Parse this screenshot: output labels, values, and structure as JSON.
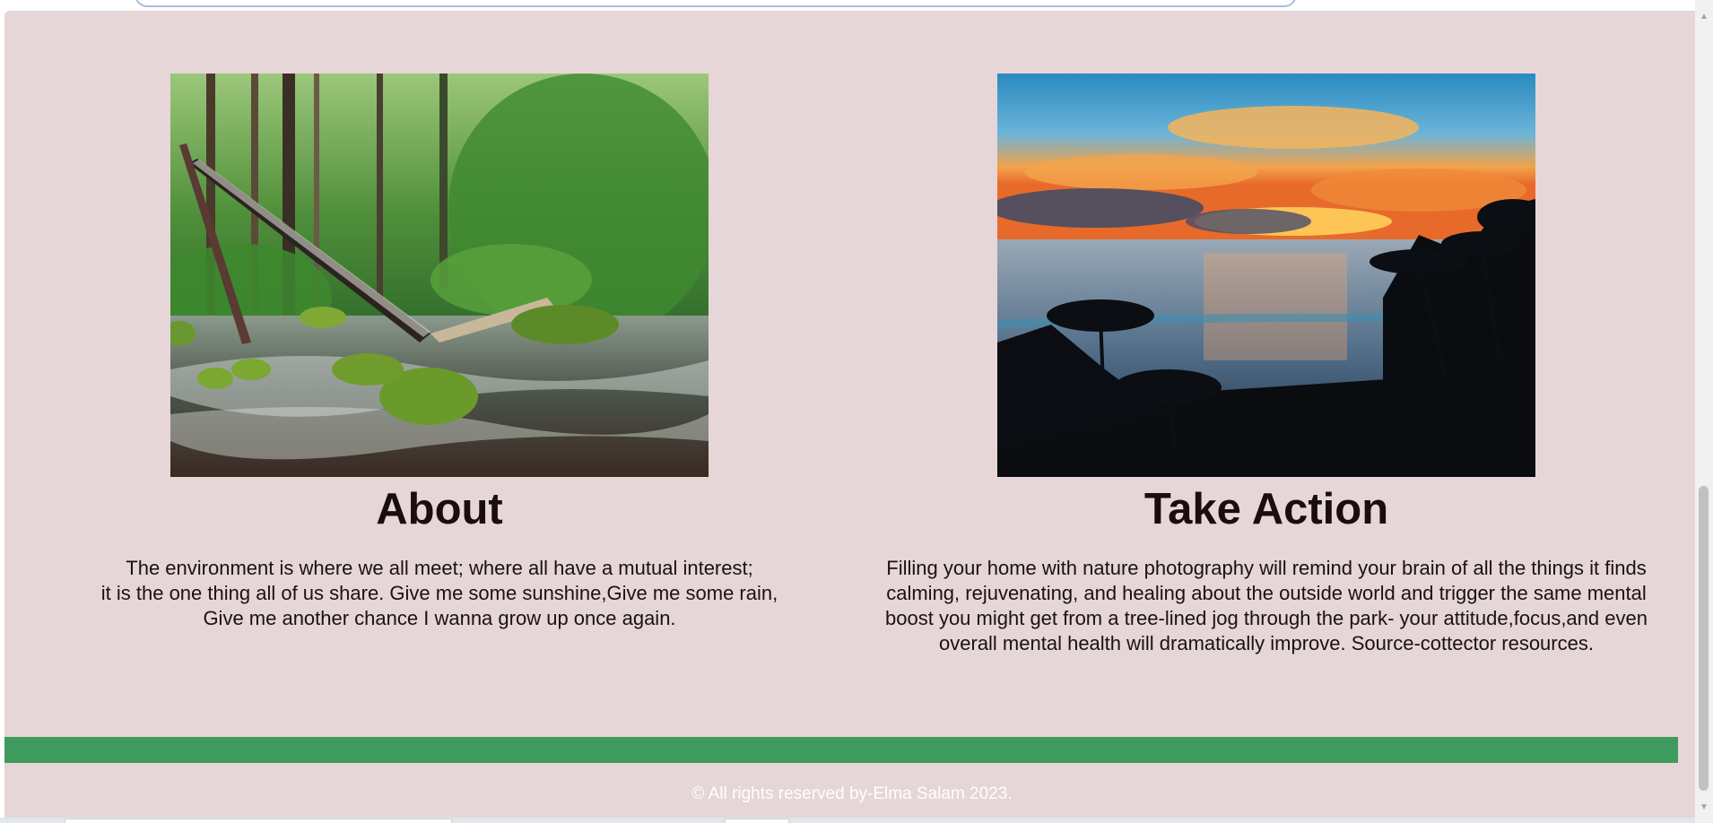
{
  "about": {
    "title": "About",
    "lines": [
      "The environment is where we all meet; where all have a mutual interest;",
      "it is the one thing all of us share. Give me some sunshine,Give me some rain,",
      "Give me another chance I wanna grow up once again."
    ]
  },
  "action": {
    "title": "Take Action",
    "text": "Filling your home with nature photography will remind your brain of all the things it finds calming, rejuvenating, and healing about the outside world and trigger the same mental boost you might get from a tree-lined jog through the park- your attitude,focus,and even overall mental health will dramatically improve. Source-cottector resources."
  },
  "footer": {
    "copyright": "© All rights reserved by-Elma Salam 2023."
  },
  "colors": {
    "panel_background": "#e6d6d7",
    "footer_bar": "#3f9b5d",
    "heading_text": "#1a0d0d"
  },
  "icons": {
    "scroll_up": "triangle-up-icon",
    "scroll_down": "triangle-down-icon"
  }
}
